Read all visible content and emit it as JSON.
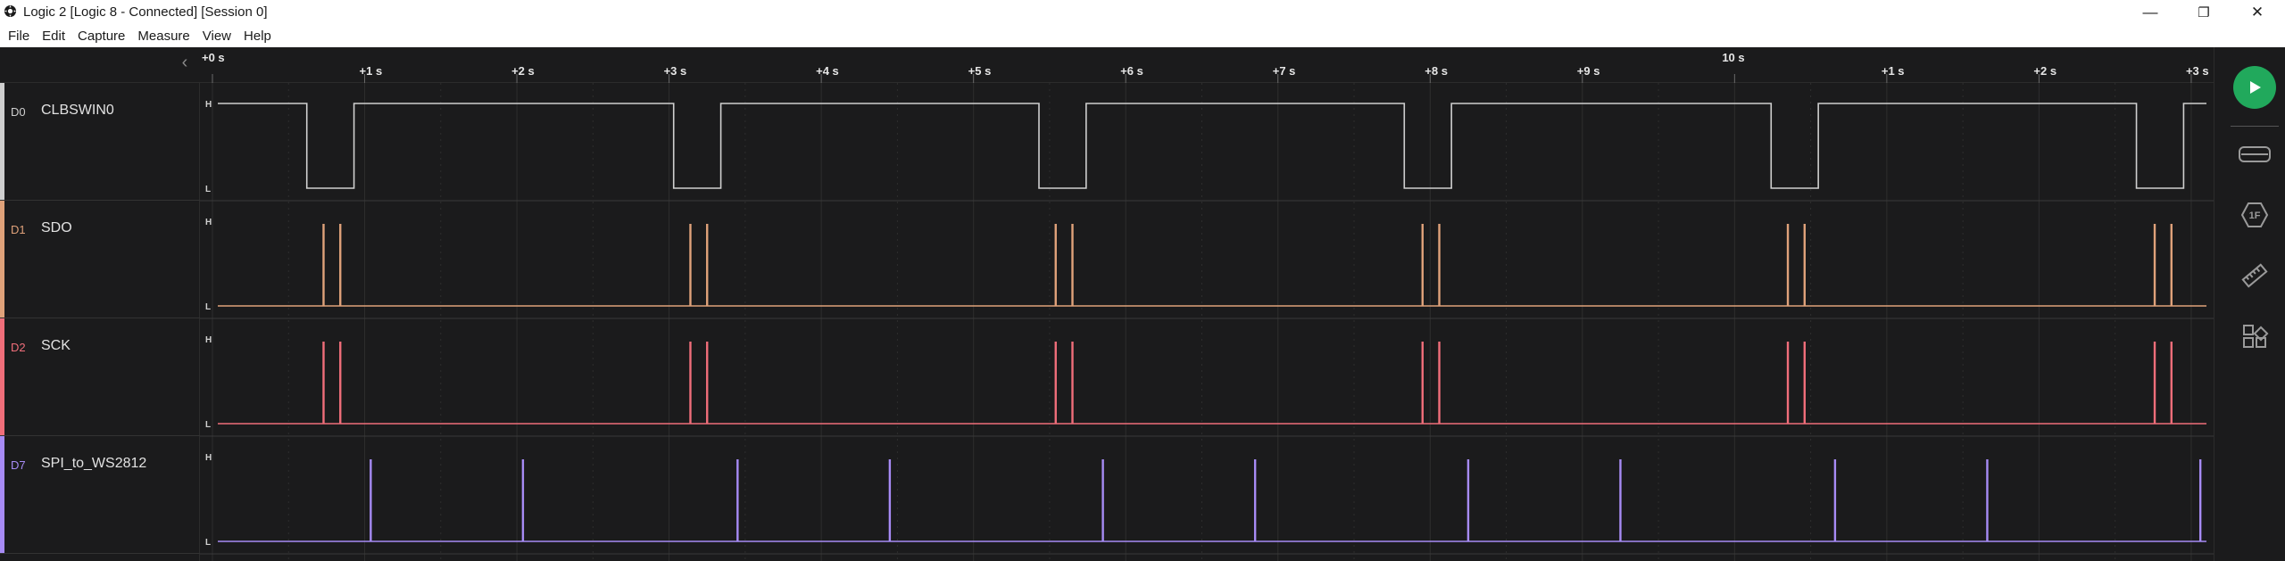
{
  "window": {
    "title": "Logic 2 [Logic 8 - Connected] [Session 0]",
    "controls": {
      "minimize": "—",
      "restore": "❐",
      "close": "✕"
    }
  },
  "menu": [
    "File",
    "Edit",
    "Capture",
    "Measure",
    "View",
    "Help"
  ],
  "timeline": {
    "collapse_glyph": "‹",
    "anchor_label": "+0 s",
    "major_label": "10 s",
    "ticks": [
      "+1 s",
      "+2 s",
      "+3 s",
      "+4 s",
      "+5 s",
      "+6 s",
      "+7 s",
      "+8 s",
      "+9 s",
      "+1 s",
      "+2 s",
      "+3 s"
    ],
    "start_s": 0.0,
    "end_s": 13.1
  },
  "level_labels": {
    "high": "H",
    "low": "L"
  },
  "channels": [
    {
      "id": "D0",
      "name": "CLBSWIN0",
      "color": "#cfcfcf",
      "signal": {
        "kind": "clock",
        "initial": "high",
        "low_intervals_s": [
          [
            0.62,
            0.93
          ],
          [
            3.03,
            3.34
          ],
          [
            5.43,
            5.74
          ],
          [
            7.83,
            8.14
          ],
          [
            10.24,
            10.55
          ],
          [
            12.64,
            12.95
          ]
        ]
      }
    },
    {
      "id": "D1",
      "name": "SDO",
      "color": "#e0a27a",
      "signal": {
        "kind": "pulses",
        "pulses_s": [
          0.73,
          0.84,
          3.14,
          3.25,
          5.54,
          5.65,
          7.95,
          8.06,
          10.35,
          10.46,
          12.76,
          12.87
        ]
      }
    },
    {
      "id": "D2",
      "name": "SCK",
      "color": "#f06e7a",
      "signal": {
        "kind": "pulses",
        "pulses_s": [
          0.73,
          0.84,
          3.14,
          3.25,
          5.54,
          5.65,
          7.95,
          8.06,
          10.35,
          10.46,
          12.76,
          12.87
        ]
      }
    },
    {
      "id": "D7",
      "name": "SPI_to_WS2812",
      "color": "#a78bf5",
      "signal": {
        "kind": "pulses",
        "pulses_s": [
          1.04,
          2.04,
          3.45,
          4.45,
          5.85,
          6.85,
          8.25,
          9.25,
          10.66,
          11.66,
          13.06
        ]
      }
    }
  ],
  "toolbar": {
    "play_icon": "play-icon",
    "items": [
      "analyzers-icon",
      "measurements-icon",
      "annotations-icon",
      "extensions-icon"
    ],
    "measure_label": "1F"
  }
}
